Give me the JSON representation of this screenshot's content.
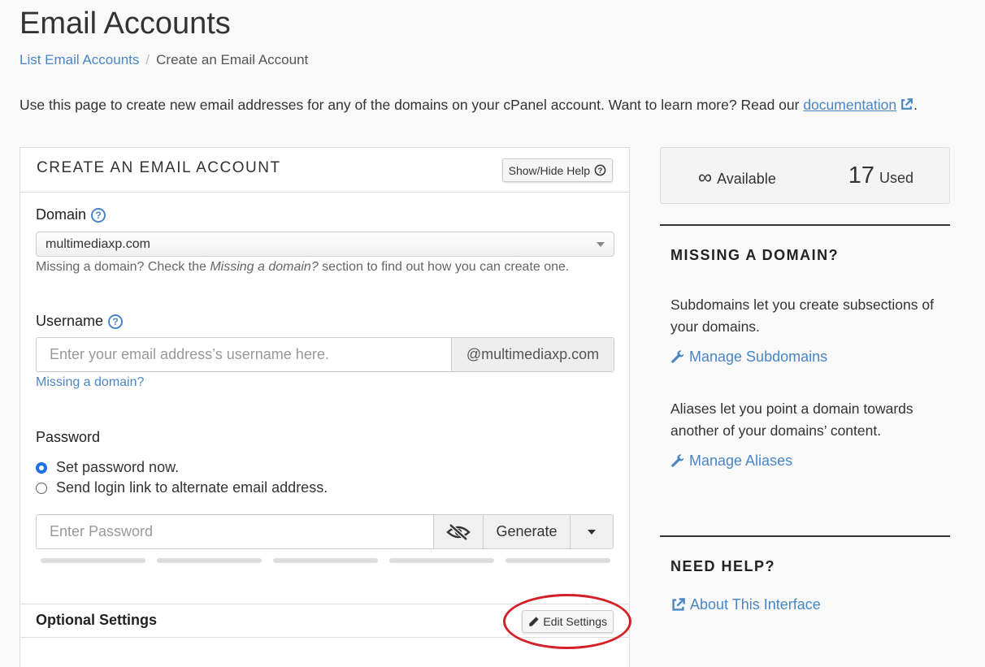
{
  "header": {
    "title": "Email Accounts",
    "breadcrumb": {
      "link": "List Email Accounts",
      "separator": "/",
      "current": "Create an Email Account"
    }
  },
  "intro": {
    "text": "Use this page to create new email addresses for any of the domains on your cPanel account. Want to learn more? Read our ",
    "link": "documentation",
    "end": "."
  },
  "form": {
    "title": "CREATE AN EMAIL ACCOUNT",
    "help_button": "Show/Hide Help",
    "domain": {
      "label": "Domain",
      "value": "multimediaxp.com",
      "hint_prefix": "Missing a domain? Check the ",
      "hint_em": "Missing a domain?",
      "hint_suffix": " section to find out how you can create one."
    },
    "username": {
      "label": "Username",
      "placeholder": "Enter your email address’s username here.",
      "suffix": "@multimediaxp.com",
      "missing_link": "Missing a domain?"
    },
    "password": {
      "label": "Password",
      "options": [
        "Set password now.",
        "Send login link to alternate email address."
      ],
      "selected": 0,
      "placeholder": "Enter Password",
      "generate": "Generate"
    },
    "optional": {
      "title": "Optional Settings",
      "edit_button": "Edit Settings"
    }
  },
  "stats": {
    "available_symbol": "∞",
    "available_label": "Available",
    "used_count": "17",
    "used_label": "Used"
  },
  "sidebar": {
    "missing": {
      "title": "MISSING A DOMAIN?",
      "subdomains_text": "Subdomains let you create subsections of your domains.",
      "subdomains_link": "Manage Subdomains",
      "aliases_text": "Aliases let you point a domain towards another of your domains’ content.",
      "aliases_link": "Manage Aliases"
    },
    "help": {
      "title": "NEED HELP?",
      "link": "About This Interface"
    }
  },
  "colors": {
    "link": "#4a86c5",
    "radio": "#1a73e8",
    "highlight": "#d42027"
  }
}
